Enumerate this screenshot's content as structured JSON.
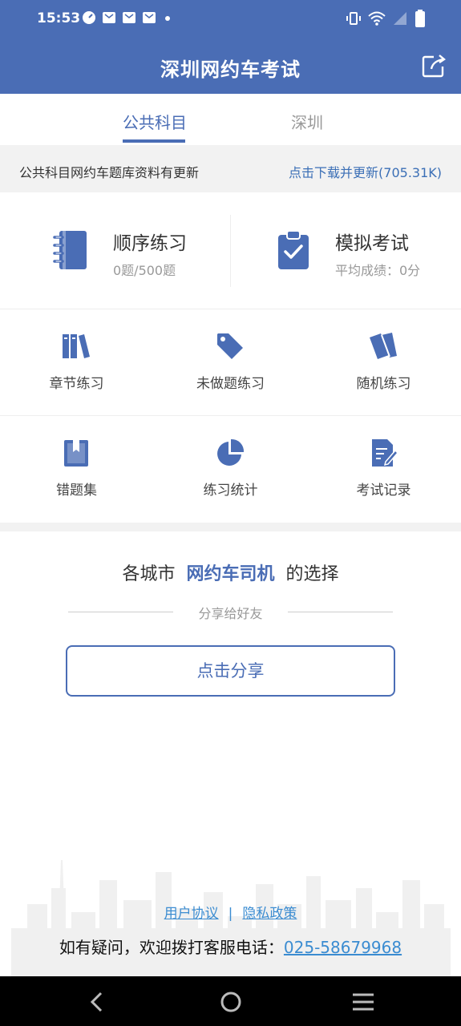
{
  "status_bar": {
    "time": "15:53",
    "notification_icons": [
      "timer-icon",
      "mail-icon",
      "mail-icon",
      "mail-icon",
      "dot-icon"
    ],
    "right_icons": [
      "vibrate-icon",
      "wifi-icon",
      "signal-icon",
      "battery-icon"
    ]
  },
  "app_bar": {
    "title": "深圳网约车考试",
    "share_icon": "share-icon"
  },
  "tabs": [
    {
      "label": "公共科目",
      "active": true
    },
    {
      "label": "深圳",
      "active": false
    }
  ],
  "notice": {
    "text": "公共科目网约车题库资料有更新",
    "link": "点击下载并更新(705.31K)"
  },
  "main_cards": [
    {
      "icon": "notebook-icon",
      "title": "顺序练习",
      "subtitle": "0题/500题"
    },
    {
      "icon": "clipboard-check-icon",
      "title": "模拟考试",
      "subtitle": "平均成绩：0分"
    }
  ],
  "grid": [
    {
      "icon": "books-icon",
      "label": "章节练习"
    },
    {
      "icon": "tag-icon",
      "label": "未做题练习"
    },
    {
      "icon": "cards-icon",
      "label": "随机练习"
    },
    {
      "icon": "bookmark-book-icon",
      "label": "错题集"
    },
    {
      "icon": "pie-chart-icon",
      "label": "练习统计"
    },
    {
      "icon": "edit-document-icon",
      "label": "考试记录"
    }
  ],
  "promo": {
    "prefix": "各城市",
    "highlight": "网约车司机",
    "suffix": "的选择",
    "share_hint": "分享给好友",
    "share_button": "点击分享"
  },
  "footer": {
    "user_agreement": "用户协议",
    "separator": "|",
    "privacy_policy": "隐私政策",
    "contact_prefix": "如有疑问，欢迎拨打客服电话：",
    "phone": "025-58679968"
  },
  "colors": {
    "primary": "#4a6db5",
    "link": "#3b8cd1"
  }
}
